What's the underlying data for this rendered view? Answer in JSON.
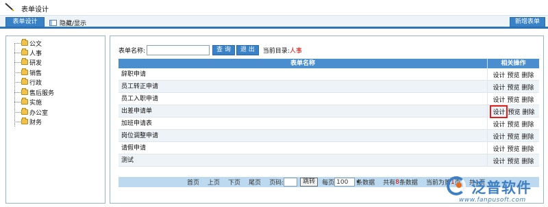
{
  "window": {
    "title": "表单设计",
    "icon": "pencil-icon"
  },
  "toolbar": {
    "tab_label": "表单设计",
    "toggle_label": "隐藏/显示",
    "new_form_label": "新增表单"
  },
  "tree": {
    "items": [
      {
        "label": "公文"
      },
      {
        "label": "人事"
      },
      {
        "label": "研发"
      },
      {
        "label": "销售"
      },
      {
        "label": "行政"
      },
      {
        "label": "售后服务"
      },
      {
        "label": "实施"
      },
      {
        "label": "办公室"
      },
      {
        "label": "财务"
      }
    ]
  },
  "search": {
    "label": "表单名称:",
    "value": "",
    "query_btn": "查 询",
    "back_btn": "退 出",
    "dir_label": "当前目录:",
    "dir_value": "人事"
  },
  "grid": {
    "headers": {
      "name": "表单名称",
      "ops": "相关操作"
    },
    "ops": {
      "design": "设计",
      "preview": "预览",
      "delete": "删除"
    },
    "rows": [
      {
        "name": "辞职申请"
      },
      {
        "name": "员工转正申请"
      },
      {
        "name": "员工入职申请"
      },
      {
        "name": "出差申请单"
      },
      {
        "name": "加班申请表"
      },
      {
        "name": "岗位调整申请"
      },
      {
        "name": "请假申请"
      },
      {
        "name": "测试"
      }
    ],
    "highlighted_row": 3
  },
  "pager": {
    "first": "首页",
    "prev": "上页",
    "next": "下页",
    "last": "尾页",
    "page_label": "页码:",
    "jump": "跳转",
    "per_page_label": "每页",
    "per_page_value": "100",
    "per_page_suffix": "条数据",
    "total_prefix": "共有",
    "total_count": "8",
    "total_suffix": "条数据",
    "current_prefix": "当前为第",
    "current_page": "1",
    "current_suffix": "页",
    "total_pages_prefix": "共1页"
  },
  "logo": {
    "brand": "泛普软件",
    "url": "www.fanpusoft.com"
  },
  "colors": {
    "accent": "#3a82c8",
    "header": "#4a8ed0",
    "pager": "#bcd9ef",
    "highlight": "#e0201d"
  }
}
